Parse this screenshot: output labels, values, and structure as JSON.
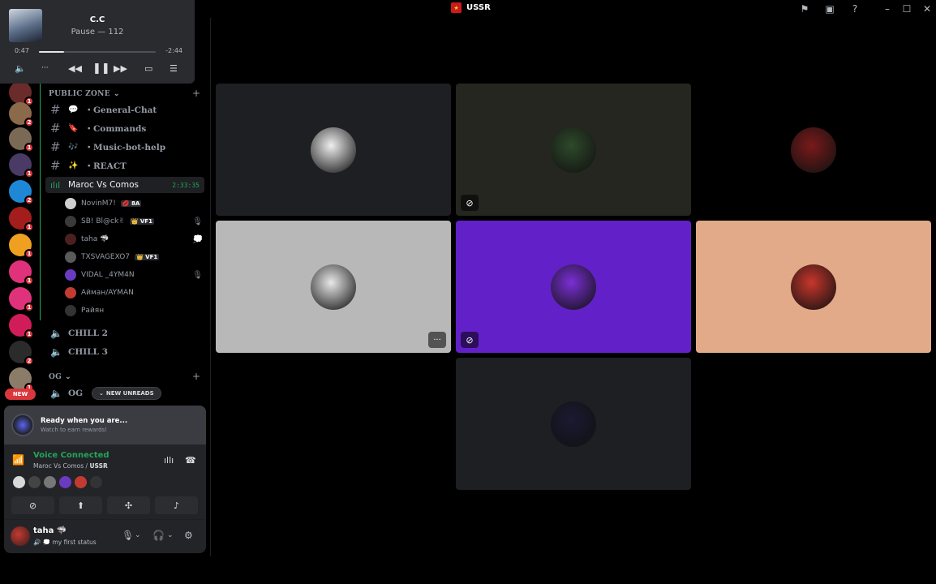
{
  "titlebar": {
    "server_name": "USSR",
    "icons": [
      "inbox-flag-icon",
      "inbox-icon",
      "help-icon",
      "minimize-icon",
      "maximize-icon",
      "close-icon"
    ]
  },
  "player": {
    "track_title": "C.C",
    "track_subtitle": "Pause — 112",
    "time_current": "0:47",
    "time_remaining": "-2:44",
    "progress_fraction": 0.215
  },
  "rail": {
    "servers": [
      {
        "badge": "1",
        "color": "#6b2b2b"
      },
      {
        "badge": "2",
        "color": "#8a6a4a"
      },
      {
        "badge": "1",
        "color": "#7a6a55"
      },
      {
        "badge": "1",
        "color": "#4a3a66"
      },
      {
        "badge": "2",
        "color": "#1e88d6"
      },
      {
        "badge": "1",
        "color": "#a31d1d"
      },
      {
        "badge": "1",
        "color": "#f0a020"
      },
      {
        "badge": "1",
        "color": "#e0327a"
      },
      {
        "badge": "1",
        "color": "#e0327a"
      },
      {
        "badge": "1",
        "color": "#d01d5a"
      },
      {
        "badge": "2",
        "color": "#2b2b2b"
      },
      {
        "badge": "1",
        "color": "#8b7c6a"
      }
    ],
    "new_label": "NEW"
  },
  "sidebar": {
    "category_public": "PUBLIC ZONE",
    "category_og": "OG",
    "channels": [
      {
        "emoji": "💬",
        "label": "・General-Chat"
      },
      {
        "emoji": "🔖",
        "label": "・Commands"
      },
      {
        "emoji": "🎶",
        "label": "・Music-bot-help"
      },
      {
        "emoji": "✨",
        "label": "・REACT"
      }
    ],
    "active_voice": {
      "label": "Maroc Vs Comos",
      "time": "2:33:35"
    },
    "voice_users": [
      {
        "name": "NovinM7!",
        "tag": "💋 8A",
        "color": "#cfcfcf",
        "right": ""
      },
      {
        "name": "SB! Bl@ck✌",
        "tag": "👑 VF1",
        "color": "#3a3a3a",
        "right": "🎙"
      },
      {
        "name": "taha 🦈",
        "tag": "",
        "color": "#4a2020",
        "right": "💭"
      },
      {
        "name": "TXSVAGEXO7",
        "tag": "👑 VF1",
        "color": "#5a5a5a",
        "right": ""
      },
      {
        "name": "VIDAL _4YM4N",
        "tag": "",
        "color": "#6a3ac0",
        "right": "🎙"
      },
      {
        "name": "Айман/AYMAN",
        "tag": "",
        "color": "#c23b32",
        "right": ""
      },
      {
        "name": "Райян",
        "tag": "",
        "color": "#333333",
        "right": ""
      }
    ],
    "voice_channels": [
      "CHILL 2",
      "CHILL 3"
    ],
    "og_channel": "OG",
    "new_unreads": "NEW UNREADS"
  },
  "stage": {
    "tiles": [
      {
        "bg": "#1e1f22",
        "avatar": "#efefef",
        "muted": false,
        "more": false
      },
      {
        "bg": "#25261f",
        "avatar": "#2e4a2a",
        "muted": true,
        "more": false
      },
      {
        "bg": "#000000",
        "avatar": "#7a1a1a",
        "muted": false,
        "more": false
      },
      {
        "bg": "#b8b8b8",
        "avatar": "#e8e8e8",
        "muted": false,
        "more": true
      },
      {
        "bg": "#6221c8",
        "avatar": "#7b2fd6",
        "muted": true,
        "more": false
      },
      {
        "bg": "#e2aa88",
        "avatar": "#c8362c",
        "muted": false,
        "more": false
      },
      {
        "bg": "#1e1f22",
        "avatar": "#1a1a33",
        "muted": false,
        "more": false
      }
    ]
  },
  "panel": {
    "promo_title": "Ready when you are...",
    "promo_sub": "Watch to earn rewards!",
    "voice_connected": "Voice Connected",
    "voice_channel": "Maroc Vs Comos / ",
    "voice_server": "USSR",
    "mini_avatars": [
      "#d9d9d9",
      "#444444",
      "#777777",
      "#6a3ac0",
      "#c23b32",
      "#333333"
    ],
    "user_name": "taha 🦈",
    "user_status": "💭 my first status"
  }
}
